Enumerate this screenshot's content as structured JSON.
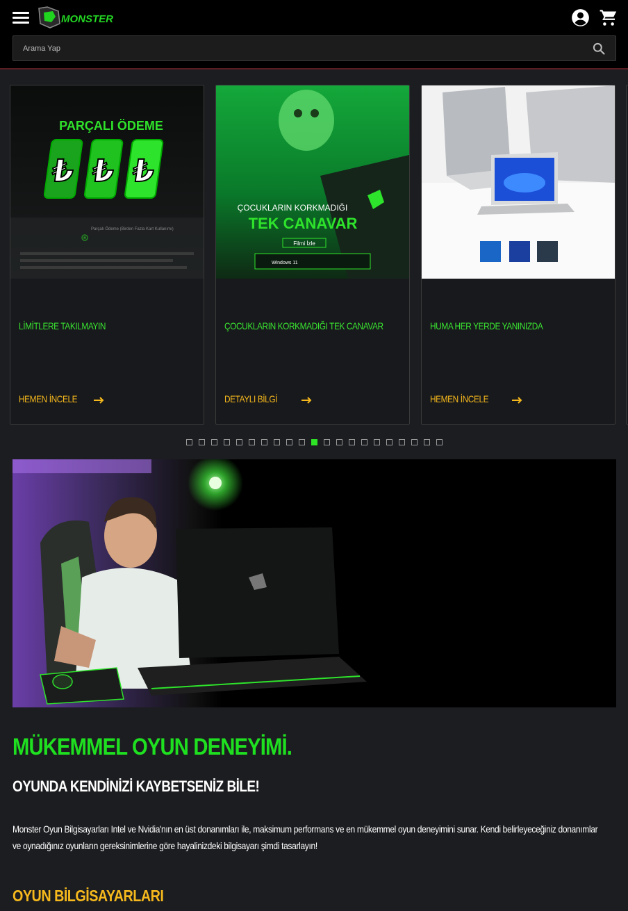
{
  "header": {
    "logo_text": "MONSTER",
    "menu_icon": "hamburger-menu-icon",
    "account_icon": "account-circle-icon",
    "cart_icon": "shopping-cart-icon"
  },
  "search": {
    "placeholder": "Arama Yap",
    "icon": "search-icon"
  },
  "carousel": {
    "cards": [
      {
        "image_text": "PARÇALI ÖDEME",
        "image_caption_1": "Parçalı Ödeme (Birden Fazla Kart Kullanımı)",
        "title": "LİMİTLERE TAKILMAYIN",
        "link": "HEMEN İNCELE"
      },
      {
        "image_text": "ÇOCUKLARIN KORKMADIĞI",
        "image_text_2": "TEK CANAVAR",
        "image_button": "Filmi İzle",
        "image_badge": "Windows 11",
        "title": "ÇOCUKLARIN KORKMADIĞI TEK CANAVAR",
        "link": "DETAYLI BİLGİ"
      },
      {
        "title": "HUMA HER YERDE YANINIZDA",
        "link": "HEMEN İNCELE"
      }
    ],
    "dot_count": 21,
    "active_dot": 10
  },
  "colors": {
    "accent_green": "#1fe020",
    "accent_orange": "#f5b81d",
    "background": "#1c1d20"
  },
  "content": {
    "headline": "MÜKEMMEL OYUN DENEYİMİ.",
    "subheadline": "OYUNDA KENDİNİZİ KAYBETSENİZ BİLE!",
    "description": "Monster Oyun Bilgisayarları Intel ve Nvidia'nın en üst donanımları ile, maksimum performans ve en mükemmel oyun deneyimini sunar. Kendi belirleyeceğiniz donanımlar ve oynadığınız oyunların gereksinimlerine göre hayalinizdeki bilgisayarı şimdi tasarlayın!",
    "section_title": "OYUN BİLGİSAYARLARI"
  }
}
